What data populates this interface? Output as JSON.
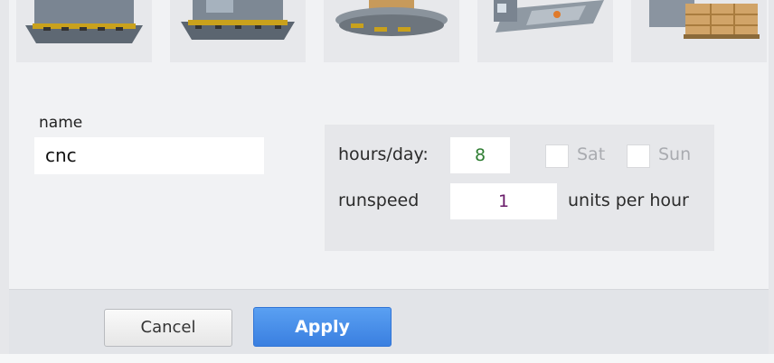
{
  "form": {
    "name_label": "name",
    "name_value": "cnc"
  },
  "schedule": {
    "hours_label": "hours/day:",
    "hours_value": "8",
    "sat_label": "Sat",
    "sun_label": "Sun",
    "sat_checked": false,
    "sun_checked": false,
    "runspeed_label": "runspeed",
    "runspeed_value": "1",
    "units_label": "units per hour"
  },
  "buttons": {
    "cancel_label": "Cancel",
    "apply_label": "Apply"
  },
  "tiles": [
    {
      "icon": "factory-building-icon"
    },
    {
      "icon": "factory-conveyor-icon"
    },
    {
      "icon": "pallet-platform-icon"
    },
    {
      "icon": "forklift-station-icon"
    },
    {
      "icon": "warehouse-boxes-icon"
    }
  ],
  "colors": {
    "apply_button": "#3a7fe0",
    "hours_value": "#2e7d32",
    "runspeed_value": "#6a1b6a"
  }
}
